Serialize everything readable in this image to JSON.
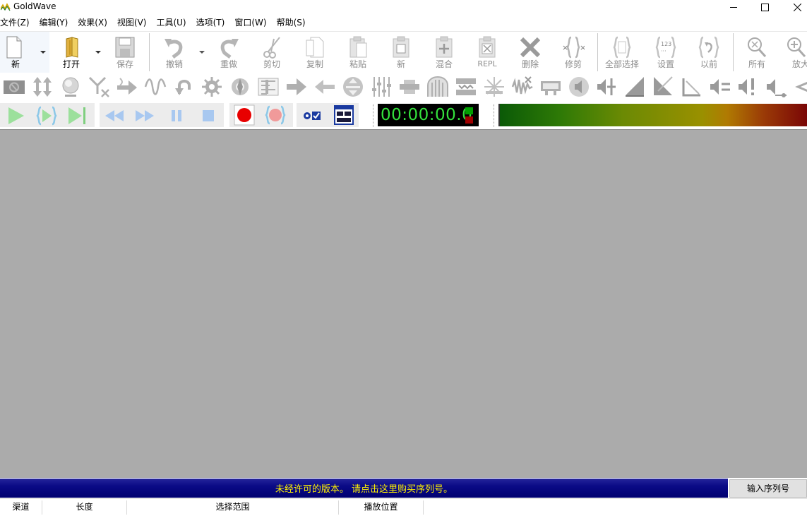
{
  "window": {
    "title": "GoldWave",
    "minimize_glyph": "minimize-icon",
    "maximize_glyph": "maximize-icon",
    "close_glyph": "close-icon"
  },
  "menu": [
    "文件(Z)",
    "编辑(Y)",
    "效果(X)",
    "视图(V)",
    "工具(U)",
    "选项(T)",
    "窗口(W)",
    "帮助(S)"
  ],
  "toolbar_main": {
    "new": "新",
    "open": "打开",
    "save": "保存",
    "undo": "撤销",
    "redo": "重做",
    "cut": "剪切",
    "copy": "复制",
    "paste": "粘贴",
    "paste_new": "新",
    "mix": "混合",
    "replace": "REPL",
    "delete": "删除",
    "trim": "修剪",
    "select_all": "全部选择",
    "set": "设置",
    "previous": "以前",
    "view_all": "所有",
    "zoom_in": "放大"
  },
  "transport": {
    "time": "00:00:00.0"
  },
  "colors": {
    "workspace": "#ababab",
    "banner_bg": "#0a0a86",
    "banner_text": "#fff200",
    "time_text": "#34e23c"
  },
  "banner": {
    "message": "未经许可的版本。 请点击这里购买序列号。",
    "serial_button": "输入序列号"
  },
  "status_columns": [
    "渠道",
    "长度",
    "选择范围",
    "播放位置"
  ]
}
